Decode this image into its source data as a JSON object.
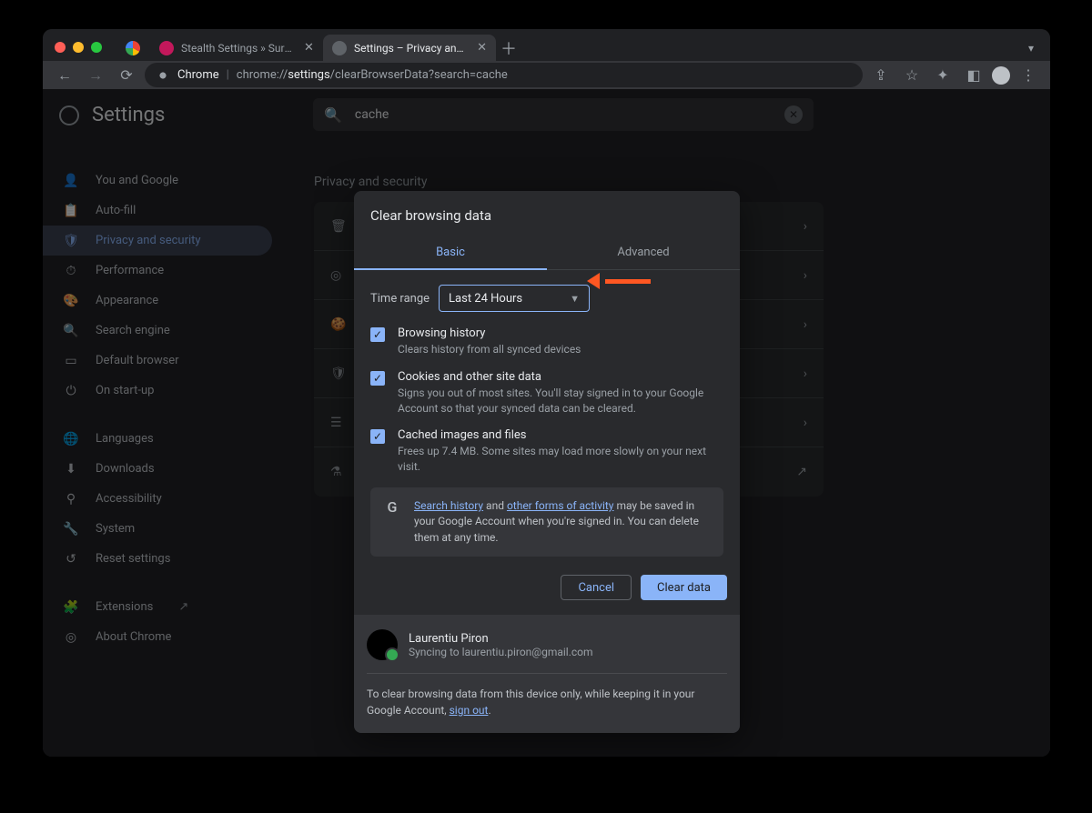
{
  "tabs": {
    "t1_label": "Stealth Settings » Sursa de tut",
    "t2_label": "Settings – Privacy and security"
  },
  "omnibox": {
    "prefix": "Chrome",
    "sep": " | ",
    "url_pre": "chrome://",
    "url_bold": "settings",
    "url_post": "/clearBrowserData?search=cache"
  },
  "app_title": "Settings",
  "search_value": "cache",
  "sidebar": {
    "items": [
      {
        "label": "You and Google"
      },
      {
        "label": "Auto-fill"
      },
      {
        "label": "Privacy and security"
      },
      {
        "label": "Performance"
      },
      {
        "label": "Appearance"
      },
      {
        "label": "Search engine"
      },
      {
        "label": "Default browser"
      },
      {
        "label": "On start-up"
      }
    ],
    "items2": [
      {
        "label": "Languages"
      },
      {
        "label": "Downloads"
      },
      {
        "label": "Accessibility"
      },
      {
        "label": "System"
      },
      {
        "label": "Reset settings"
      }
    ],
    "items3": [
      {
        "label": "Extensions"
      },
      {
        "label": "About Chrome"
      }
    ]
  },
  "page_section_title": "Privacy and security",
  "modal": {
    "title": "Clear browsing data",
    "tab_basic": "Basic",
    "tab_advanced": "Advanced",
    "time_range_label": "Time range",
    "time_range_value": "Last 24 Hours",
    "opt1_title": "Browsing history",
    "opt1_desc": "Clears history from all synced devices",
    "opt2_title": "Cookies and other site data",
    "opt2_desc": "Signs you out of most sites. You'll stay signed in to your Google Account so that your synced data can be cleared.",
    "opt3_title": "Cached images and files",
    "opt3_desc": "Frees up 7.4 MB. Some sites may load more slowly on your next visit.",
    "info_link1": "Search history",
    "info_mid1": " and ",
    "info_link2": "other forms of activity",
    "info_rest": " may be saved in your Google Account when you're signed in. You can delete them at any time.",
    "btn_cancel": "Cancel",
    "btn_clear": "Clear data",
    "user_name": "Laurentiu Piron",
    "user_sync": "Syncing to laurentiu.piron@gmail.com",
    "foot_note_pre": "To clear browsing data from this device only, while keeping it in your Google Account, ",
    "foot_note_link": "sign out",
    "foot_note_post": "."
  }
}
